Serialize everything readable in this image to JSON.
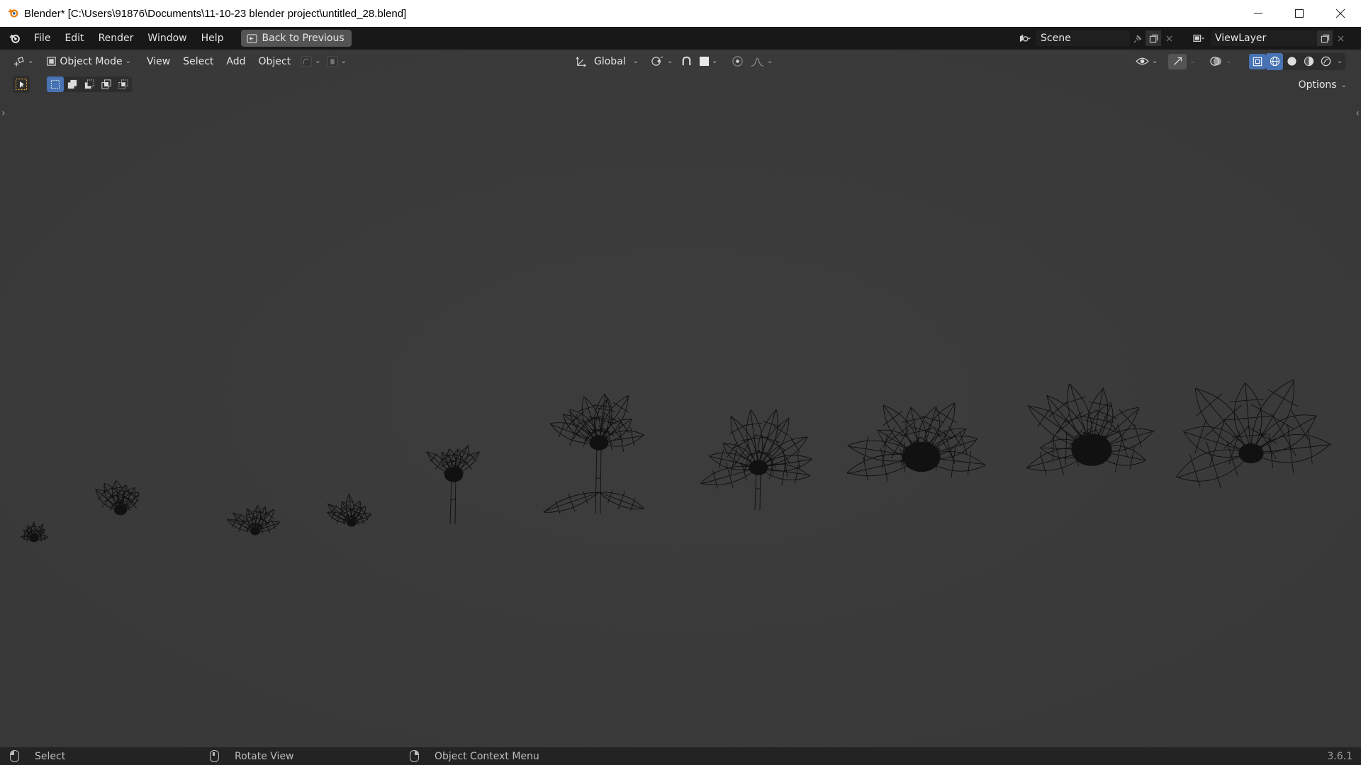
{
  "window": {
    "title": "Blender* [C:\\Users\\91876\\Documents\\11-10-23 blender project\\untitled_28.blend]",
    "controls": [
      "minimize-icon",
      "maximize-icon",
      "close-icon"
    ]
  },
  "topbar": {
    "menus": [
      "File",
      "Edit",
      "Render",
      "Window",
      "Help"
    ],
    "back_button": "Back to Previous",
    "scene": "Scene",
    "view_layer": "ViewLayer"
  },
  "viewport_header": {
    "mode": "Object Mode",
    "menus": [
      "View",
      "Select",
      "Add",
      "Object"
    ],
    "transform_orientation": "Global",
    "options_label": "Options"
  },
  "statusbar": {
    "select": "Select",
    "rotate": "Rotate View",
    "context_menu": "Object Context Menu",
    "version": "3.6.1"
  },
  "viewport": {
    "background_color": "#3a3a3a",
    "wire_color": "#0f0f0f",
    "content": "wireframe flower models in various bloom stages"
  },
  "colors": {
    "accent": "#4772b3",
    "blender_orange": "#e87d0d"
  }
}
